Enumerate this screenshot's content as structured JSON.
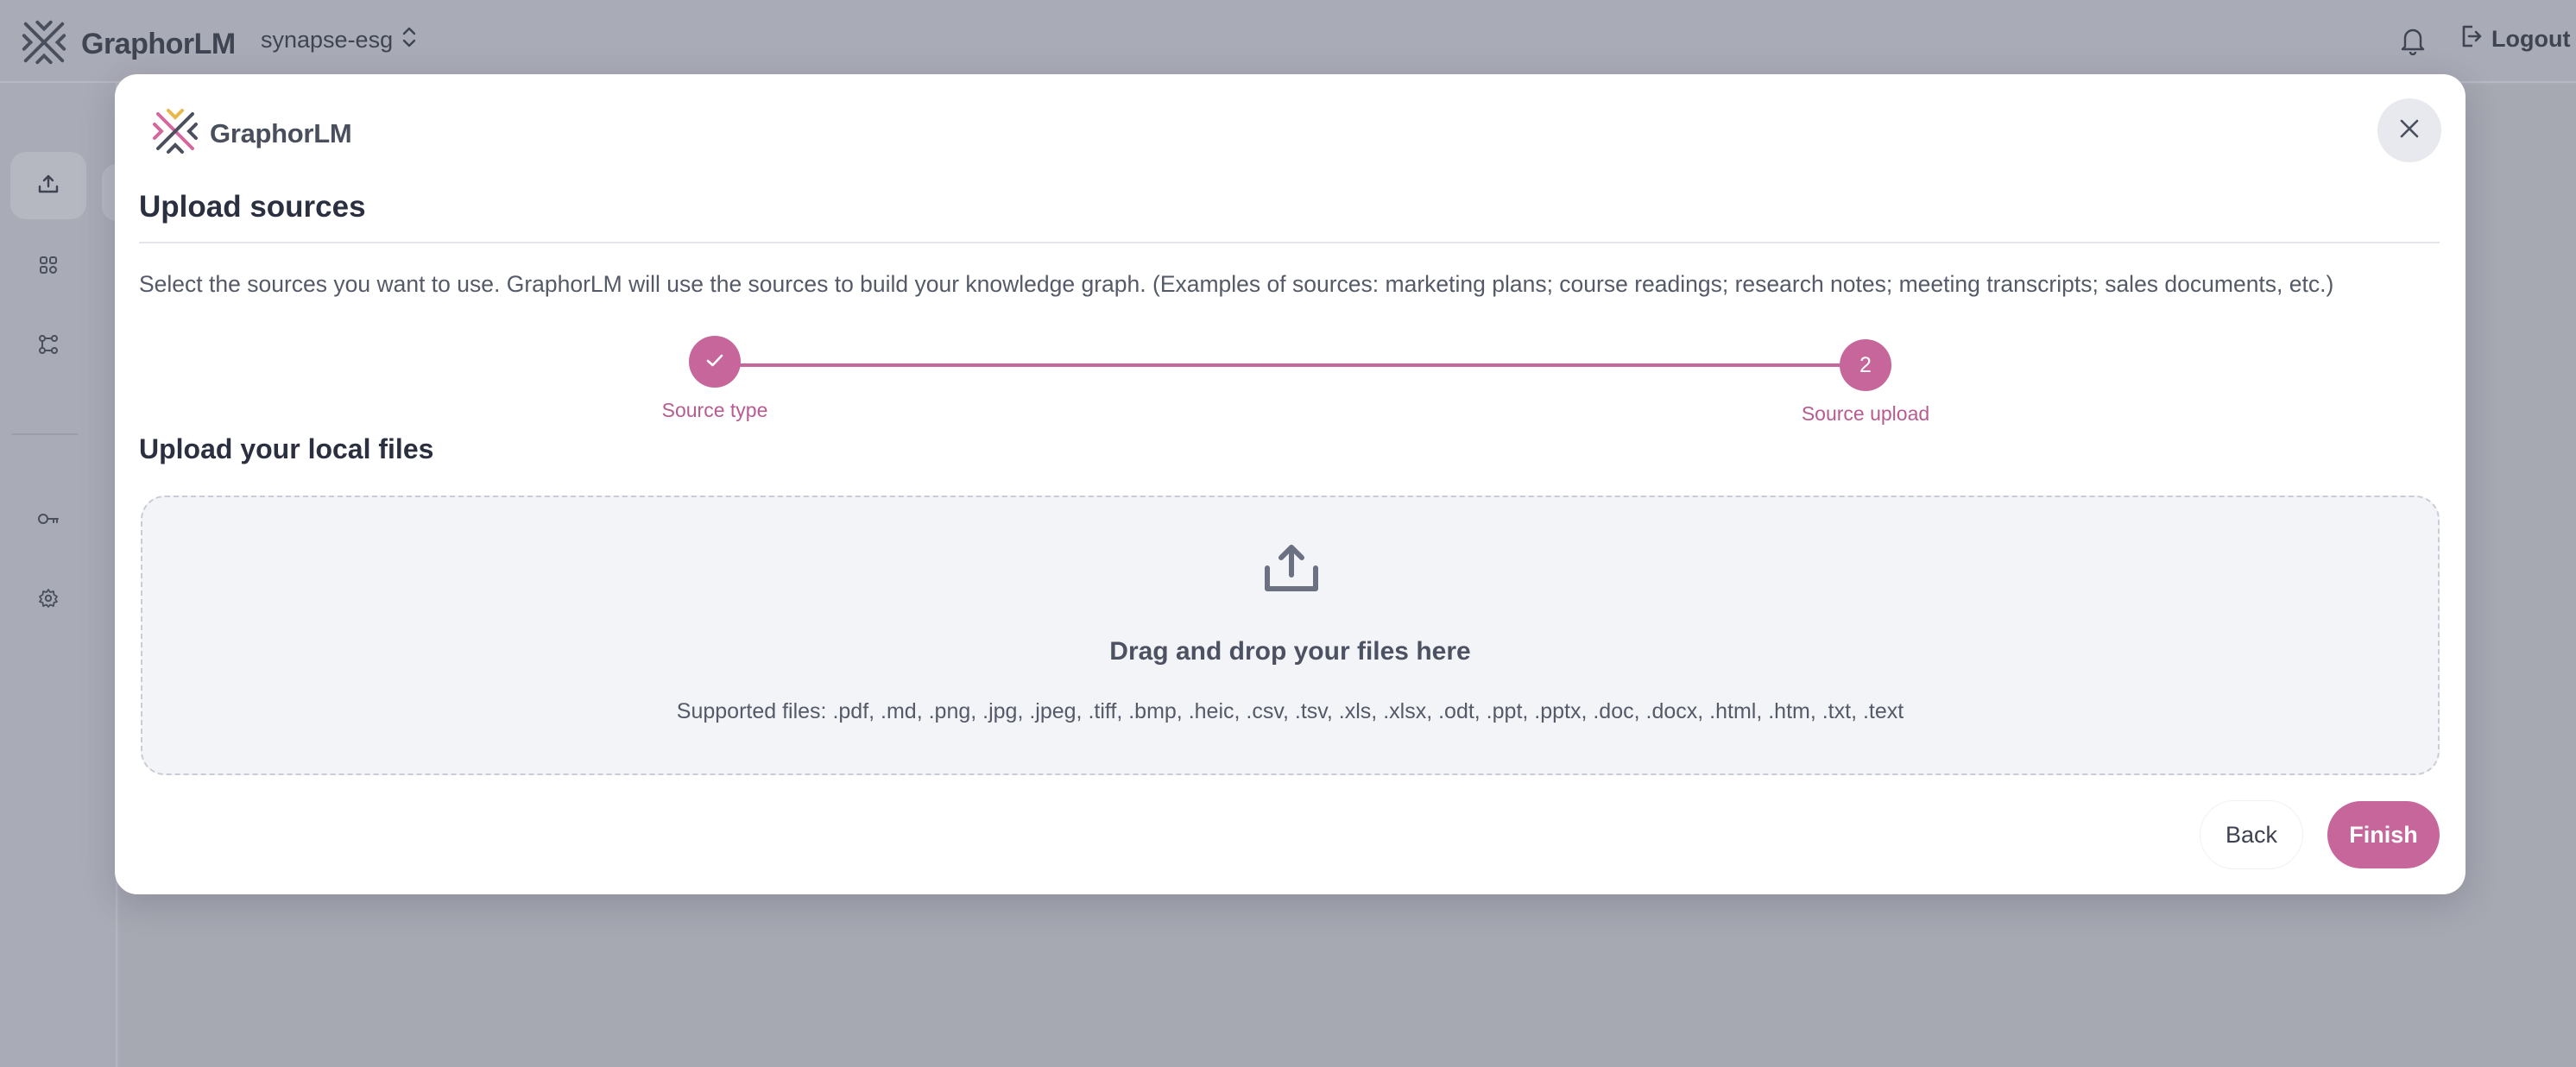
{
  "app": {
    "brand_name": "GraphorLM",
    "workspace_name": "synapse-esg",
    "logout_label": "Logout"
  },
  "icons": {
    "logo": "graphorlm-logo-icon",
    "workspace_switch": "chevron-up-down-icon",
    "notifications": "bell-icon",
    "logout": "logout-icon",
    "sidebar": [
      "upload-icon",
      "sources-icon",
      "flow-icon",
      "key-icon",
      "settings-icon"
    ],
    "close": "close-icon",
    "step_done": "check-icon",
    "dropzone": "upload-tray-icon"
  },
  "modal": {
    "brand_name": "GraphorLM",
    "title": "Upload sources",
    "description": "Select the sources you want to use. GraphorLM will use the sources to build your knowledge graph. (Examples of sources: marketing plans; course readings; research notes; meeting transcripts; sales documents, etc.)",
    "steps": [
      {
        "number": "1",
        "label": "Source type",
        "state": "completed"
      },
      {
        "number": "2",
        "label": "Source upload",
        "state": "current"
      }
    ],
    "section_title": "Upload your local files",
    "dropzone": {
      "title": "Drag and drop your files here",
      "supported": "Supported files: .pdf, .md, .png, .jpg, .jpeg, .tiff, .bmp, .heic, .csv, .tsv, .xls, .xlsx, .odt, .ppt, .pptx, .doc, .docx, .html, .htm, .txt, .text"
    },
    "back_label": "Back",
    "finish_label": "Finish"
  },
  "colors": {
    "accent": "#c7669b",
    "overlay": "#a9abb6",
    "text_dark": "#2b3040",
    "dropzone_bg": "#f3f4f8"
  }
}
